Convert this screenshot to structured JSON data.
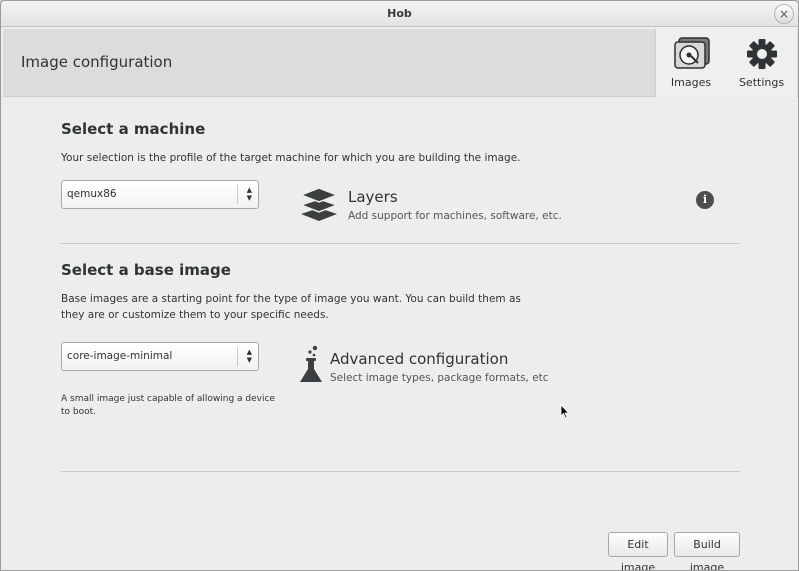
{
  "window": {
    "title": "Hob",
    "close_glyph": "×"
  },
  "header": {
    "title": "Image configuration",
    "toolbar": [
      {
        "label": "Images",
        "icon": "hard-disk-icon"
      },
      {
        "label": "Settings",
        "icon": "gear-icon"
      }
    ]
  },
  "machine": {
    "title": "Select a machine",
    "description": "Your selection is the profile of the target machine for which you are building the image.",
    "selected": "qemux86"
  },
  "layers": {
    "title": "Layers",
    "subtitle": "Add support for machines, software, etc.",
    "info_glyph": "i"
  },
  "base_image": {
    "title": "Select a base image",
    "description_line1": "Base images are a starting point for the type of image you want. You can build them as",
    "description_line2": "they are or customize them to your specific needs.",
    "selected": "core-image-minimal",
    "help_line1": "A small image just capable of allowing a device",
    "help_line2": "to boot."
  },
  "advanced": {
    "title": "Advanced configuration",
    "subtitle": "Select image types, package formats, etc"
  },
  "actions": {
    "edit_label": "Edit image",
    "build_label": "Build image"
  },
  "colors": {
    "header_bg": "#dcdcdc",
    "window_bg": "#ededed",
    "text": "#2e3436"
  }
}
